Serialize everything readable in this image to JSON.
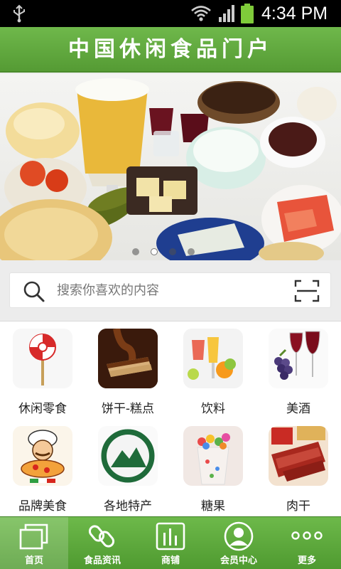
{
  "status_bar": {
    "time": "4:34 PM"
  },
  "header": {
    "title": "中国休闲食品门户"
  },
  "banner": {
    "slides": 4,
    "active_slide": 1
  },
  "search": {
    "placeholder": "搜索你喜欢的内容"
  },
  "categories": [
    {
      "label": "休闲零食",
      "icon": "lollipop-icon"
    },
    {
      "label": "饼干-糕点",
      "icon": "chocolate-biscuit-icon"
    },
    {
      "label": "饮料",
      "icon": "drinks-icon"
    },
    {
      "label": "美酒",
      "icon": "wine-icon"
    },
    {
      "label": "品牌美食",
      "icon": "chef-pizza-icon"
    },
    {
      "label": "各地特产",
      "icon": "mountain-seal-icon"
    },
    {
      "label": "糖果",
      "icon": "candy-cup-icon"
    },
    {
      "label": "肉干",
      "icon": "jerky-icon"
    }
  ],
  "bottom_nav": [
    {
      "label": "首页",
      "icon": "home-window-icon",
      "active": true
    },
    {
      "label": "食品资讯",
      "icon": "link-icon",
      "active": false
    },
    {
      "label": "商铺",
      "icon": "store-chart-icon",
      "active": false
    },
    {
      "label": "会员中心",
      "icon": "user-icon",
      "active": false
    },
    {
      "label": "更多",
      "icon": "more-dots-icon",
      "active": false
    }
  ],
  "colors": {
    "primary_green": "#5ca83b",
    "dark_green": "#4a8a2c"
  }
}
